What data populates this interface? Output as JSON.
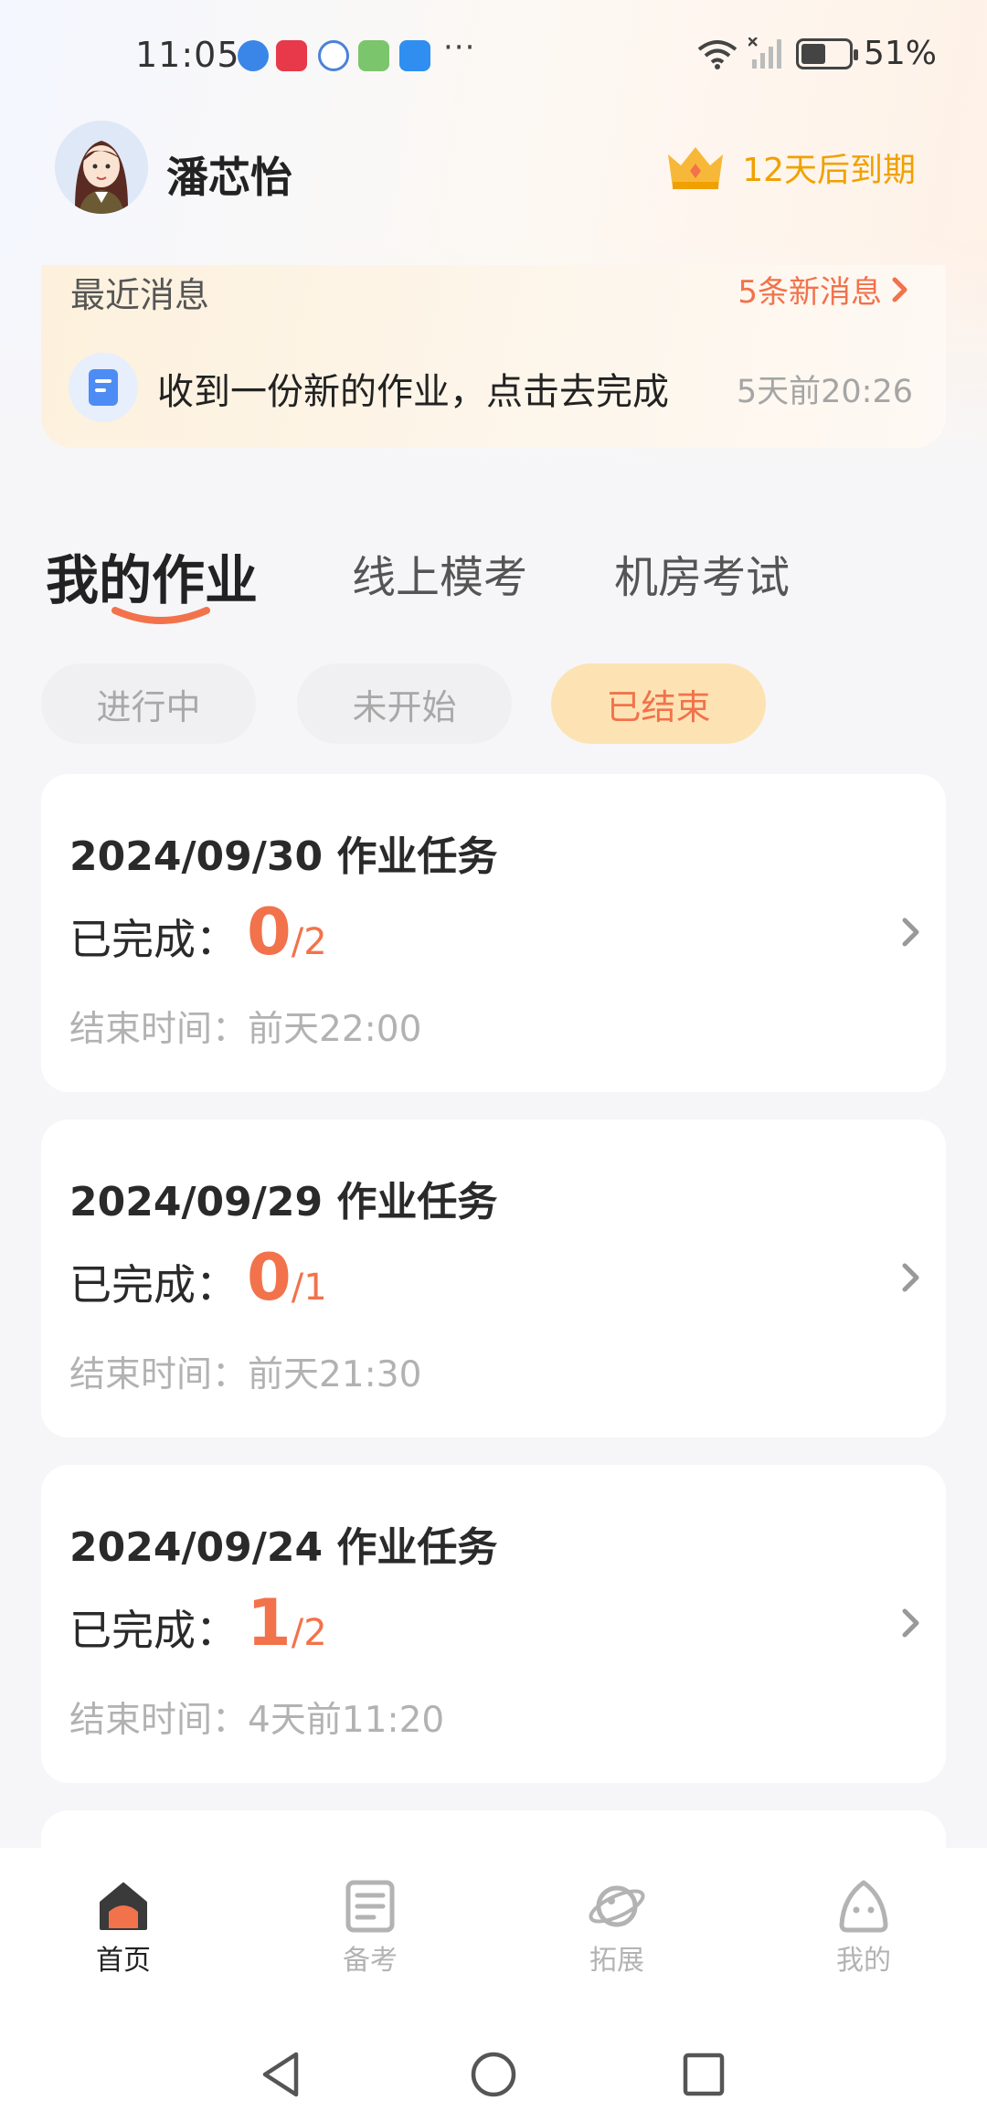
{
  "status_bar": {
    "time": "11:05",
    "battery": "51%",
    "more": "···"
  },
  "header": {
    "user_name": "潘芯怡",
    "vip_expiry": "12天后到期",
    "vip_color": "#f0a100"
  },
  "messages": {
    "title": "最近消息",
    "new_count": "5条新消息",
    "latest_text": "收到一份新的作业，点击去完成",
    "latest_time": "5天前20:26"
  },
  "tabs": [
    {
      "label": "我的作业",
      "active": true
    },
    {
      "label": "线上模考",
      "active": false
    },
    {
      "label": "机房考试",
      "active": false
    }
  ],
  "filters": [
    {
      "label": "进行中",
      "active": false
    },
    {
      "label": "未开始",
      "active": false
    },
    {
      "label": "已结束",
      "active": true
    }
  ],
  "tasks": [
    {
      "title": "2024/09/30 作业任务",
      "label": "已完成：",
      "done": "0",
      "total": "/2",
      "end": "结束时间：前天22:00"
    },
    {
      "title": "2024/09/29 作业任务",
      "label": "已完成：",
      "done": "0",
      "total": "/1",
      "end": "结束时间：前天21:30"
    },
    {
      "title": "2024/09/24 作业任务",
      "label": "已完成：",
      "done": "1",
      "total": "/2",
      "end": "结束时间：4天前11:20"
    }
  ],
  "bottom_nav": [
    {
      "label": "首页",
      "icon": "home-icon",
      "active": true
    },
    {
      "label": "备考",
      "icon": "notebook-icon",
      "active": false
    },
    {
      "label": "拓展",
      "icon": "planet-icon",
      "active": false
    },
    {
      "label": "我的",
      "icon": "profile-icon",
      "active": false
    }
  ],
  "colors": {
    "accent": "#f2724b",
    "pill_active_bg": "#fde3b3",
    "message_bg": "#fdf1dd"
  }
}
